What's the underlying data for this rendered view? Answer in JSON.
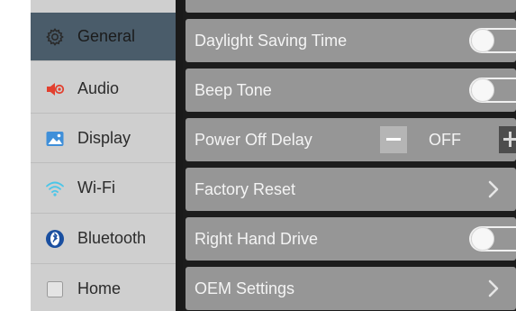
{
  "sidebar": {
    "items": [
      {
        "label": "General",
        "icon": "gear-icon",
        "active": true
      },
      {
        "label": "Audio",
        "icon": "speaker-icon",
        "active": false
      },
      {
        "label": "Display",
        "icon": "image-icon",
        "active": false
      },
      {
        "label": "Wi-Fi",
        "icon": "wifi-icon",
        "active": false
      },
      {
        "label": "Bluetooth",
        "icon": "bluetooth-icon",
        "active": false
      },
      {
        "label": "Home",
        "icon": "home-icon",
        "active": false
      }
    ]
  },
  "settings": {
    "rows": [
      {
        "label": "Daylight Saving Time",
        "control": "toggle",
        "on": false
      },
      {
        "label": "Beep Tone",
        "control": "toggle",
        "on": false
      },
      {
        "label": "Power Off Delay",
        "control": "stepper",
        "value": "OFF"
      },
      {
        "label": "Factory Reset",
        "control": "chevron"
      },
      {
        "label": "Right Hand Drive",
        "control": "toggle",
        "on": false
      },
      {
        "label": "OEM Settings",
        "control": "chevron"
      }
    ]
  },
  "colors": {
    "sidebar_bg": "#cfcfcf",
    "sidebar_active": "#4a5c6a",
    "row_bg": "#969696",
    "background": "#1c1c1c",
    "audio_icon": "#e2402f",
    "display_icon": "#3f8fd9",
    "wifi_icon": "#4bc6e8",
    "bluetooth_icon": "#1a4fa0"
  }
}
